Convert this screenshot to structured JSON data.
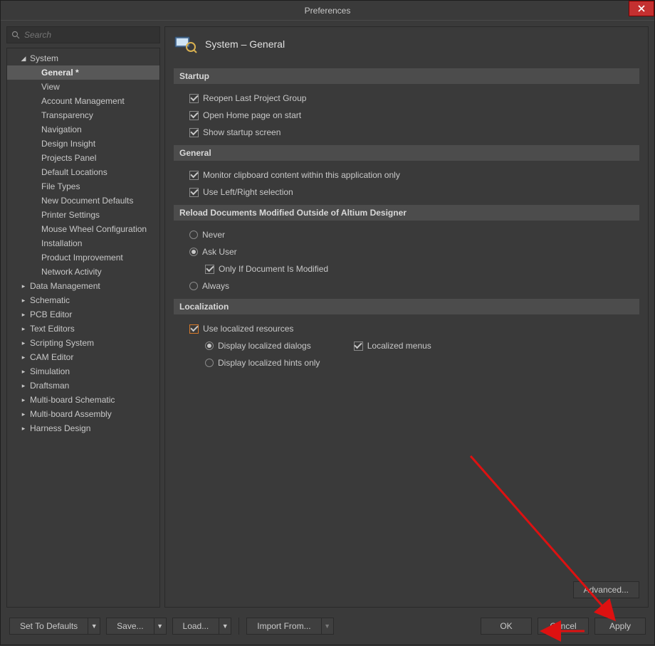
{
  "window": {
    "title": "Preferences"
  },
  "search": {
    "placeholder": "Search"
  },
  "tree": {
    "system": {
      "label": "System",
      "children": [
        "General *",
        "View",
        "Account Management",
        "Transparency",
        "Navigation",
        "Design Insight",
        "Projects Panel",
        "Default Locations",
        "File Types",
        "New Document Defaults",
        "Printer Settings",
        "Mouse Wheel Configuration",
        "Installation",
        "Product Improvement",
        "Network Activity"
      ]
    },
    "roots": [
      "Data Management",
      "Schematic",
      "PCB Editor",
      "Text Editors",
      "Scripting System",
      "CAM Editor",
      "Simulation",
      "Draftsman",
      "Multi-board Schematic",
      "Multi-board Assembly",
      "Harness Design"
    ]
  },
  "page": {
    "title": "System – General",
    "sections": {
      "startup": {
        "header": "Startup",
        "reopen": "Reopen Last Project Group",
        "openhome": "Open Home page on start",
        "showstartup": "Show startup screen"
      },
      "general": {
        "header": "General",
        "clipboard": "Monitor clipboard content within this application only",
        "leftright": "Use Left/Right selection"
      },
      "reload": {
        "header": "Reload Documents Modified Outside of Altium Designer",
        "never": "Never",
        "askuser": "Ask User",
        "onlyif": "Only If Document Is Modified",
        "always": "Always"
      },
      "localization": {
        "header": "Localization",
        "use": "Use localized resources",
        "dialogs": "Display localized dialogs",
        "menus": "Localized menus",
        "hints": "Display localized hints only"
      }
    },
    "advanced": "Advanced..."
  },
  "footer": {
    "defaults": "Set To Defaults",
    "save": "Save...",
    "load": "Load...",
    "import": "Import From...",
    "ok": "OK",
    "cancel": "Cancel",
    "apply": "Apply"
  }
}
